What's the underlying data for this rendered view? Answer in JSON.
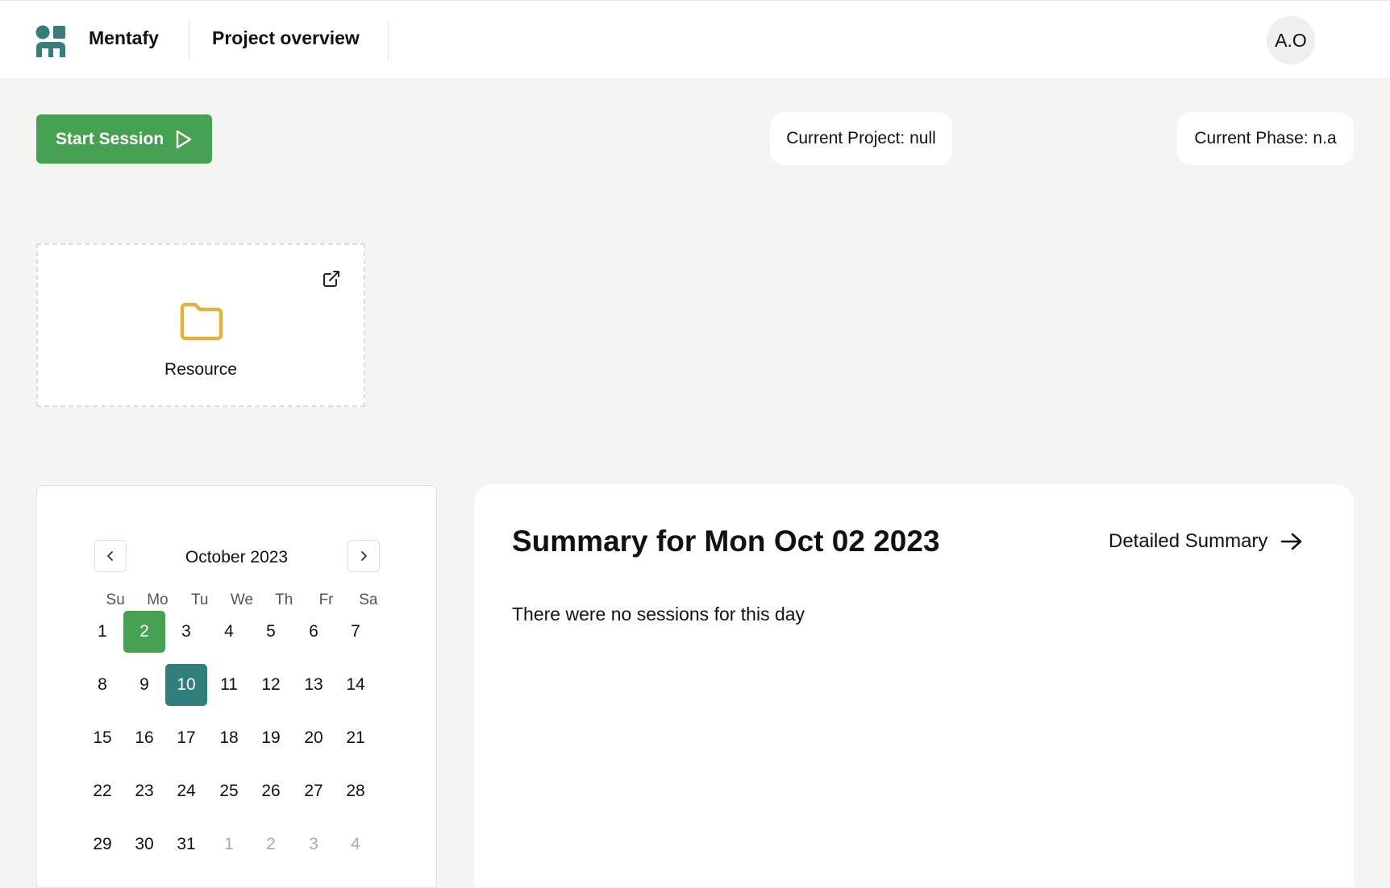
{
  "header": {
    "brand": "Mentafy",
    "nav_title": "Project overview",
    "avatar_initials": "A.O"
  },
  "toolbar": {
    "start_label": "Start Session",
    "current_project": "Current Project: null",
    "current_phase": "Current Phase: n.a"
  },
  "resource": {
    "label": "Resource"
  },
  "calendar": {
    "title": "October 2023",
    "weekdays": [
      "Su",
      "Mo",
      "Tu",
      "We",
      "Th",
      "Fr",
      "Sa"
    ],
    "selected_day": "2",
    "today": "10",
    "weeks": [
      [
        "1",
        "2",
        "3",
        "4",
        "5",
        "6",
        "7"
      ],
      [
        "8",
        "9",
        "10",
        "11",
        "12",
        "13",
        "14"
      ],
      [
        "15",
        "16",
        "17",
        "18",
        "19",
        "20",
        "21"
      ],
      [
        "22",
        "23",
        "24",
        "25",
        "26",
        "27",
        "28"
      ],
      [
        "29",
        "30",
        "31",
        "1",
        "2",
        "3",
        "4"
      ]
    ],
    "trailing_days_next_month": [
      "1",
      "2",
      "3",
      "4"
    ]
  },
  "summary": {
    "title": "Summary for Mon Oct 02 2023",
    "detail_link": "Detailed Summary",
    "empty_text": "There were no sessions for this day"
  },
  "colors": {
    "accent_green": "#47a153",
    "today_teal": "#2f7f7a",
    "logo_teal": "#3a7c7a",
    "folder_yellow": "#e1b23d"
  },
  "icons": {
    "play": "play-icon",
    "external_link": "external-link-icon",
    "folder": "folder-icon",
    "chevron_left": "chevron-left-icon",
    "chevron_right": "chevron-right-icon",
    "arrow_right": "arrow-right-icon"
  }
}
